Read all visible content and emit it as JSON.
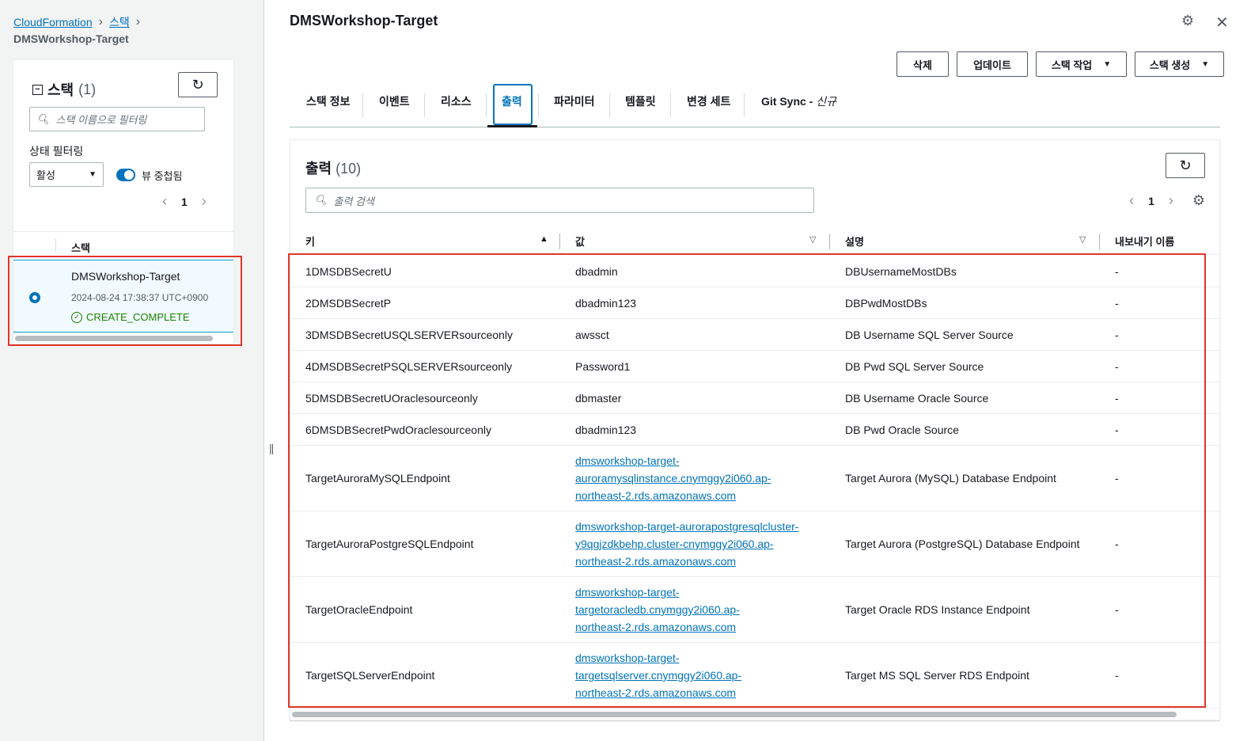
{
  "breadcrumb": {
    "root": "CloudFormation",
    "stacks": "스택",
    "current": "DMSWorkshop-Target"
  },
  "left_panel": {
    "title": "스택",
    "count": "(1)",
    "filter_placeholder": "스택 이름으로 필터링",
    "status_filter_label": "상태 필터링",
    "status_filter_value": "활성",
    "nested_view_label": "뷰 중첩됨",
    "page": "1",
    "column_header": "스택",
    "stack": {
      "name": "DMSWorkshop-Target",
      "created": "2024-08-24 17:38:37 UTC+0900",
      "status": "CREATE_COMPLETE"
    }
  },
  "main": {
    "title": "DMSWorkshop-Target",
    "actions": {
      "delete": "삭제",
      "update": "업데이트",
      "stack_actions": "스택 작업",
      "create_stack": "스택 생성"
    },
    "tabs": [
      {
        "label": "스택 정보"
      },
      {
        "label": "이벤트"
      },
      {
        "label": "리소스"
      },
      {
        "label": "출력"
      },
      {
        "label": "파라미터"
      },
      {
        "label": "템플릿"
      },
      {
        "label": "변경 세트"
      },
      {
        "label": "Git Sync - ",
        "tag": "신규"
      }
    ],
    "outputs": {
      "title": "출력",
      "count": "(10)",
      "search_placeholder": "출력 검색",
      "page": "1",
      "columns": {
        "key": "키",
        "value": "값",
        "description": "설명",
        "export": "내보내기 이름"
      },
      "rows": [
        {
          "key": "1DMSDBSecretU",
          "value": [
            "dbadmin"
          ],
          "link": false,
          "desc": "DBUsernameMostDBs",
          "export": "-"
        },
        {
          "key": "2DMSDBSecretP",
          "value": [
            "dbadmin123"
          ],
          "link": false,
          "desc": "DBPwdMostDBs",
          "export": "-"
        },
        {
          "key": "3DMSDBSecretUSQLSERVERsourceonly",
          "value": [
            "awssct"
          ],
          "link": false,
          "desc": "DB Username SQL Server Source",
          "export": "-"
        },
        {
          "key": "4DMSDBSecretPSQLSERVERsourceonly",
          "value": [
            "Password1"
          ],
          "link": false,
          "desc": "DB Pwd SQL Server Source",
          "export": "-"
        },
        {
          "key": "5DMSDBSecretUOraclesourceonly",
          "value": [
            "dbmaster"
          ],
          "link": false,
          "desc": "DB Username Oracle Source",
          "export": "-"
        },
        {
          "key": "6DMSDBSecretPwdOraclesourceonly",
          "value": [
            "dbadmin123"
          ],
          "link": false,
          "desc": "DB Pwd Oracle Source",
          "export": "-"
        },
        {
          "key": "TargetAuroraMySQLEndpoint",
          "value": [
            "dmsworkshop-target-",
            "auroramysqlinstance.cnymggy2i060.ap-",
            "northeast-2.rds.amazonaws.com"
          ],
          "link": true,
          "desc": "Target Aurora (MySQL) Database Endpoint",
          "export": "-"
        },
        {
          "key": "TargetAuroraPostgreSQLEndpoint",
          "value": [
            "dmsworkshop-target-aurorapostgresqlcluster-",
            "y9qgjzdkbehp.cluster-cnymggy2i060.ap-",
            "northeast-2.rds.amazonaws.com"
          ],
          "link": true,
          "desc": "Target Aurora (PostgreSQL) Database Endpoint",
          "export": "-"
        },
        {
          "key": "TargetOracleEndpoint",
          "value": [
            "dmsworkshop-target-",
            "targetoracledb.cnymggy2i060.ap-",
            "northeast-2.rds.amazonaws.com"
          ],
          "link": true,
          "desc": "Target Oracle RDS Instance Endpoint",
          "export": "-"
        },
        {
          "key": "TargetSQLServerEndpoint",
          "value": [
            "dmsworkshop-target-",
            "targetsqlserver.cnymggy2i060.ap-",
            "northeast-2.rds.amazonaws.com"
          ],
          "link": true,
          "desc": "Target MS SQL Server RDS Endpoint",
          "export": "-"
        }
      ]
    }
  },
  "colors": {
    "accent": "#0073bb",
    "success": "#1d8102",
    "highlight_border": "#e0362b"
  }
}
